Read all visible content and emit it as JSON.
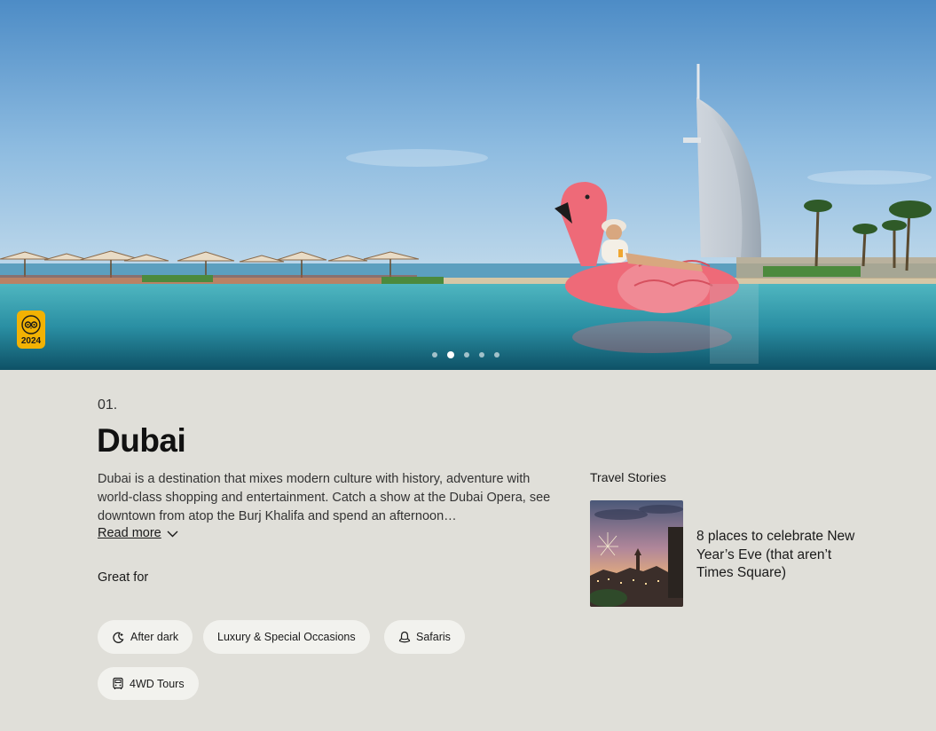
{
  "hero": {
    "award_year": "2024",
    "slide_count": 5,
    "active_slide": 2
  },
  "destination": {
    "rank": "01.",
    "name": "Dubai",
    "description": "Dubai is a destination that mixes modern culture with history, adventure with world-class shopping and entertainment. Catch a show at the Dubai Opera, see downtown from atop the Burj Khalifa and spend an afternoon…",
    "read_more_label": "Read more"
  },
  "great_for": {
    "heading": "Great for",
    "tags": [
      {
        "label": "After dark",
        "icon": "moon-star-icon"
      },
      {
        "label": "Luxury & Special Occasions",
        "icon": ""
      },
      {
        "label": "Safaris",
        "icon": "safari-hat-icon"
      },
      {
        "label": "4WD Tours",
        "icon": "vehicle-icon"
      }
    ]
  },
  "travel_stories": {
    "heading": "Travel Stories",
    "items": [
      {
        "title": "8 places to celebrate New Year’s Eve (that aren’t Times Square)"
      }
    ]
  },
  "colors": {
    "background": "#e0dfd9",
    "chip": "#f2f2ee",
    "award_badge": "#f2b203"
  }
}
